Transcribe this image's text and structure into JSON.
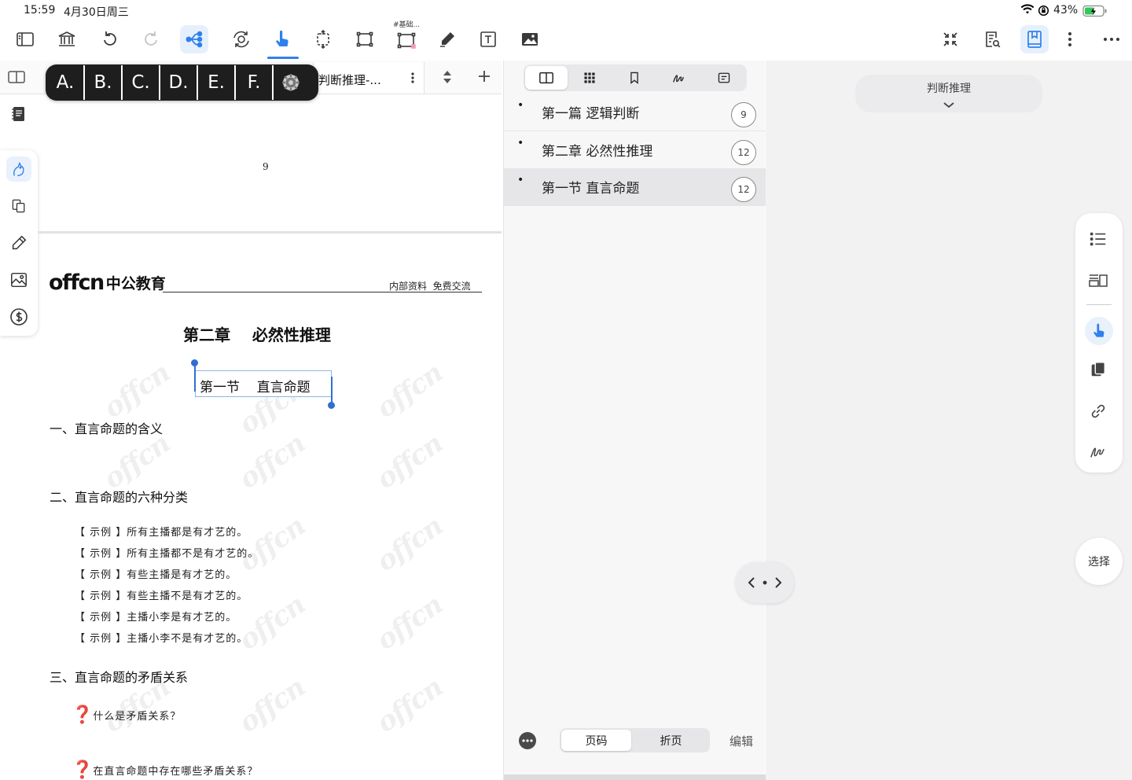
{
  "status": {
    "time": "15:59",
    "date": "4月30日周三",
    "battery": "43%"
  },
  "toolbar": {
    "tag_label": "#基础..."
  },
  "quick_answer": {
    "options": [
      "A.",
      "B.",
      "C.",
      "D.",
      "E.",
      "F."
    ]
  },
  "tab": {
    "title": "判断推理-..."
  },
  "document": {
    "page_number": "9",
    "logo_text": "offcn",
    "logo_cn": "中公教育",
    "header_note": "内部资料  免费交流",
    "chapter_title": "第二章    必然性推理",
    "section_title": "第一节    直言命题",
    "heading1": "一、直言命题的含义",
    "heading2": "二、直言命题的六种分类",
    "examples": [
      "【 示例 】所有主播都是有才艺的。",
      "【 示例 】所有主播都不是有才艺的。",
      "【 示例 】有些主播是有才艺的。",
      "【 示例 】有些主播不是有才艺的。",
      "【 示例 】主播小李是有才艺的。",
      "【 示例 】主播小李不是有才艺的。"
    ],
    "heading3": "三、直言命题的矛盾关系",
    "q1": "什么是矛盾关系？",
    "q2": "在直言命题中存在哪些矛盾关系？",
    "q_icon": "❓",
    "watermark": "offcn"
  },
  "outline": {
    "items": [
      {
        "title": "第一篇  逻辑判断",
        "page": "9",
        "selected": false
      },
      {
        "title": "第二章  必然性推理",
        "page": "12",
        "selected": false
      },
      {
        "title": "第一节  直言命题",
        "page": "12",
        "selected": true
      }
    ],
    "bottom": {
      "segment_left": "页码",
      "segment_right": "折页",
      "edit": "编辑"
    }
  },
  "right": {
    "dropdown_label": "判断推理",
    "select_label": "选择"
  },
  "colors": {
    "accent": "#2f80ed",
    "panel_bg": "#f7f7f8"
  }
}
